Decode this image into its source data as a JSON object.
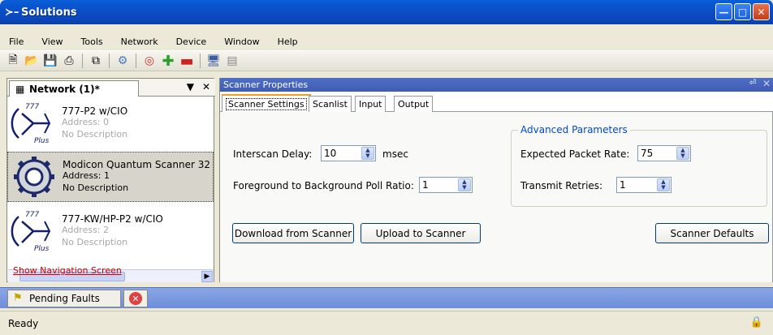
{
  "window": {
    "title": "Solutions"
  },
  "menu": [
    "File",
    "View",
    "Tools",
    "Network",
    "Device",
    "Window",
    "Help"
  ],
  "network_panel": {
    "tab_label": "Network (1)*",
    "nodes": [
      {
        "badge": "777",
        "sub": "Plus",
        "name": "777-P2 w/CIO",
        "address": "Address: 0",
        "description": "No Description",
        "selected": false
      },
      {
        "badge": "",
        "sub": "",
        "name": "Modicon Quantum Scanner 32",
        "address": "Address: 1",
        "description": "No Description",
        "selected": true
      },
      {
        "badge": "777",
        "sub": "Plus",
        "name": "777-KW/HP-P2 w/CIO",
        "address": "Address: 2",
        "description": "No Description",
        "selected": false
      }
    ],
    "nav_link": "Show Navigation Screen"
  },
  "scanner_panel": {
    "header": "Scanner Properties",
    "tabs": [
      "Scanner Settings",
      "Scanlist",
      "Input",
      "Output"
    ],
    "interscan_label": "Interscan Delay:",
    "interscan_value": "10",
    "interscan_unit": "msec",
    "poll_ratio_label": "Foreground to Background Poll Ratio:",
    "poll_ratio_value": "1",
    "advanced_title": "Advanced Parameters",
    "packet_rate_label": "Expected Packet Rate:",
    "packet_rate_value": "75",
    "retries_label": "Transmit Retries:",
    "retries_value": "1",
    "download_btn": "Download from Scanner",
    "upload_btn": "Upload to Scanner",
    "defaults_btn": "Scanner Defaults"
  },
  "bottom": {
    "faults_tab": "Pending Faults"
  },
  "status": {
    "text": "Ready"
  }
}
